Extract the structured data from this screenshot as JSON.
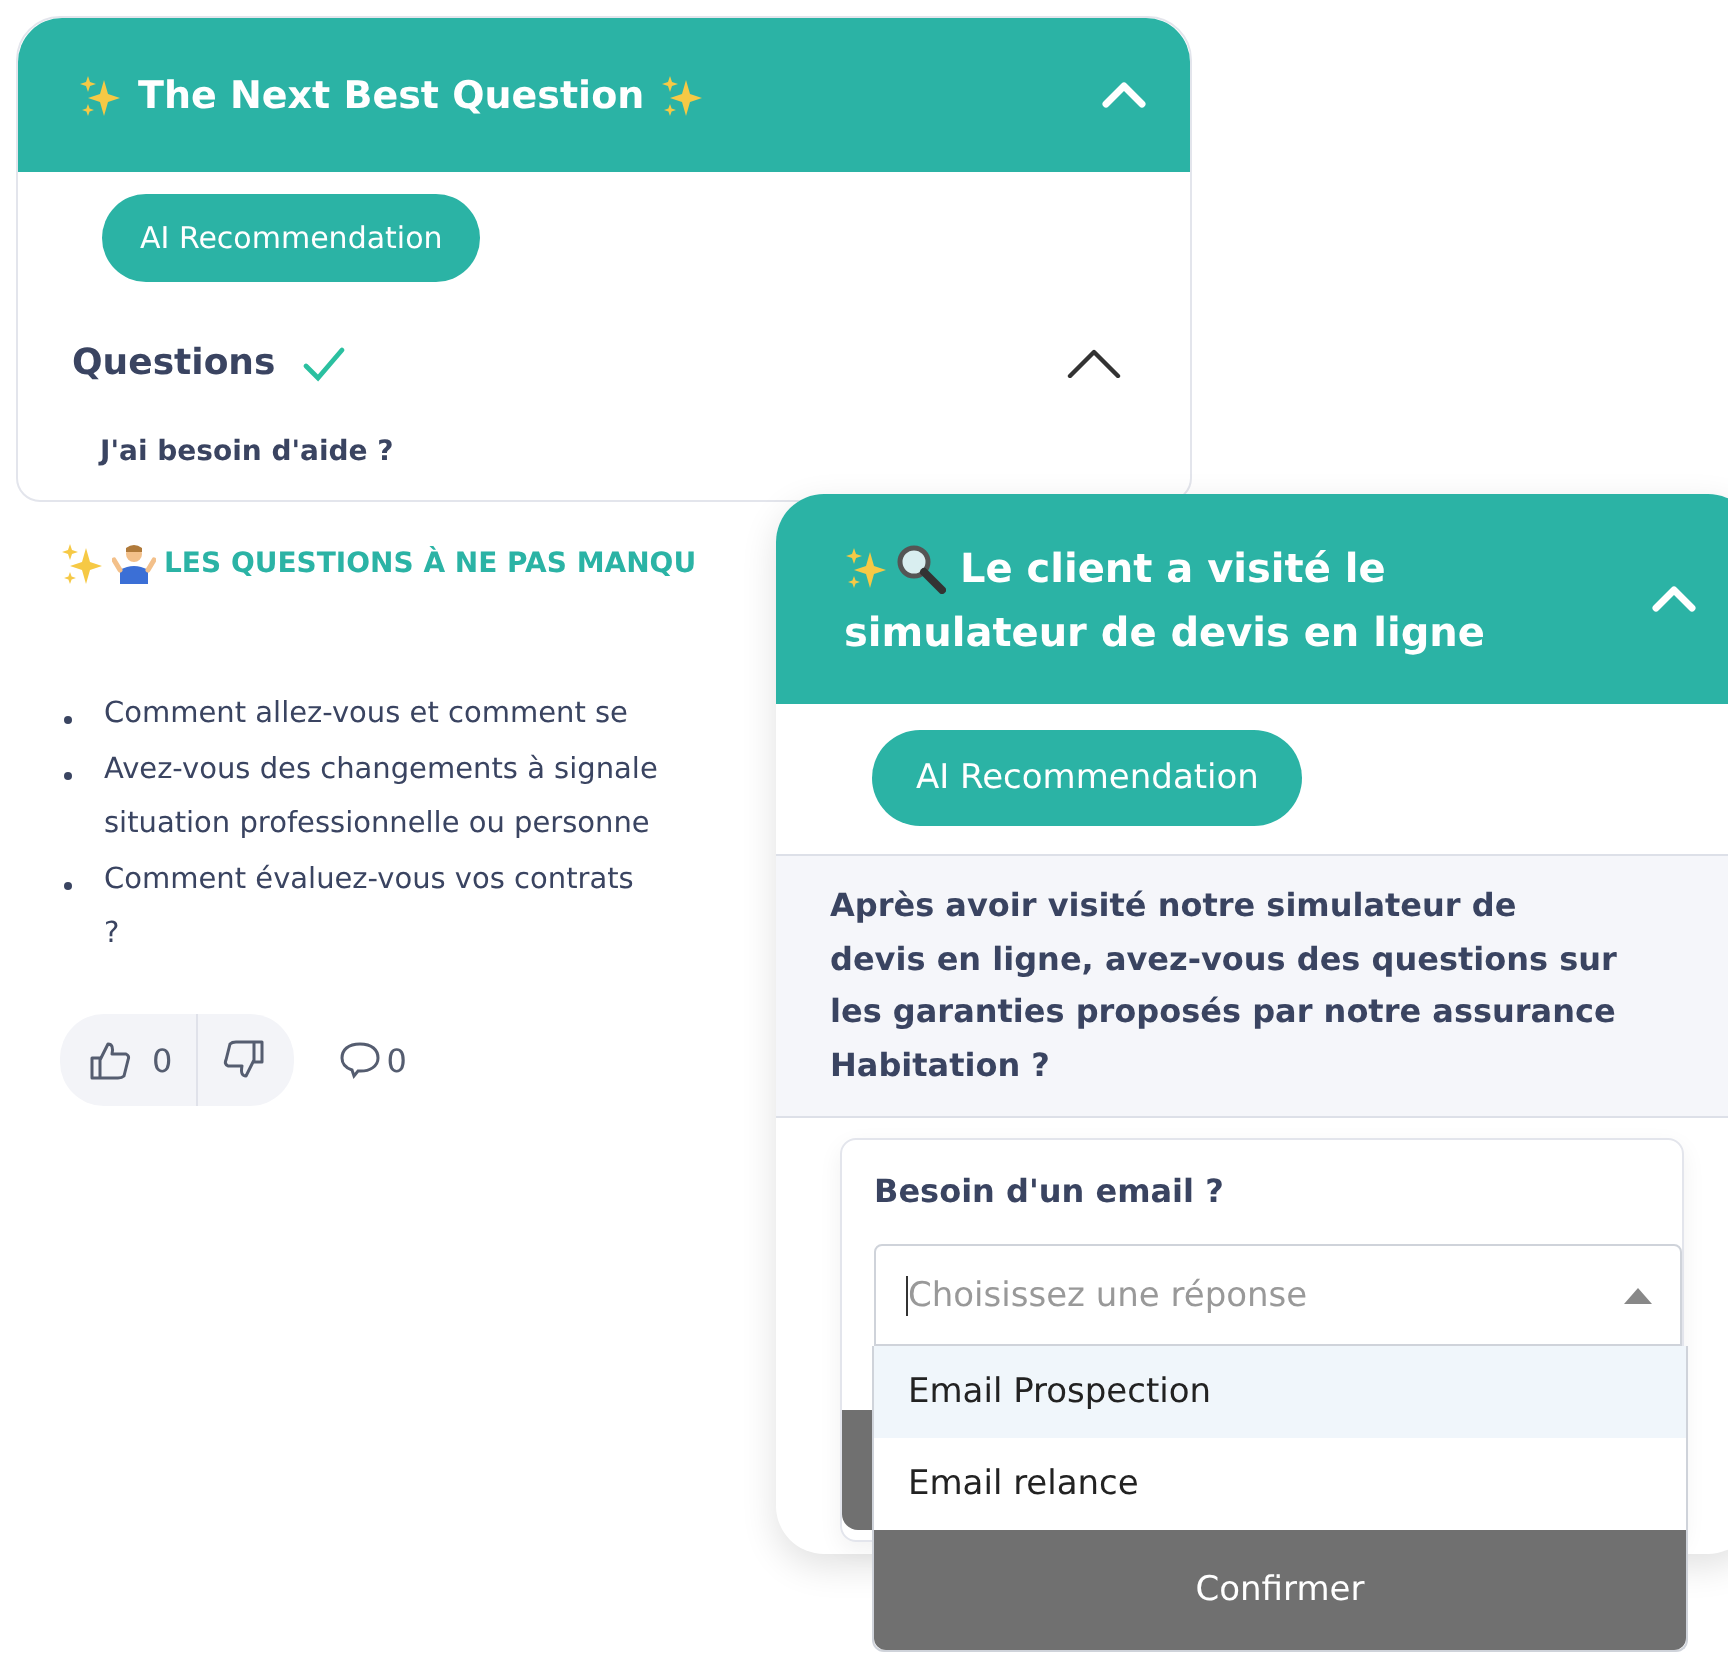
{
  "main_panel": {
    "title": "The Next Best Question",
    "expanded": true,
    "badge": "AI Recommendation",
    "questions": {
      "label": "Questions",
      "done": true,
      "expanded": true,
      "items": [
        "J'ai besoin d'aide ?"
      ]
    }
  },
  "must_ask": {
    "heading": "LES QUESTIONS À NE PAS MANQU",
    "items": [
      {
        "lines": [
          "Comment allez-vous et comment se"
        ]
      },
      {
        "lines": [
          "Avez-vous des changements à signale",
          "situation professionnelle ou personne"
        ]
      },
      {
        "lines": [
          "Comment évaluez-vous vos contrats",
          "?"
        ]
      }
    ],
    "likes": "0",
    "comments": "0"
  },
  "popup": {
    "title_lines": [
      "Le client a visité le",
      "simulateur de devis en ligne"
    ],
    "expanded": true,
    "badge": "AI Recommendation",
    "question": "Après avoir visité notre simulateur de devis en ligne, avez-vous des questions sur les garanties proposés par notre assurance Habitation ?",
    "form": {
      "label": "Besoin d'un email ?",
      "placeholder": "Choisissez une réponse",
      "open": true,
      "options": [
        {
          "label": "Email Prospection",
          "highlighted": true
        },
        {
          "label": "Email relance",
          "highlighted": false
        }
      ],
      "button": "Confirmer"
    }
  }
}
